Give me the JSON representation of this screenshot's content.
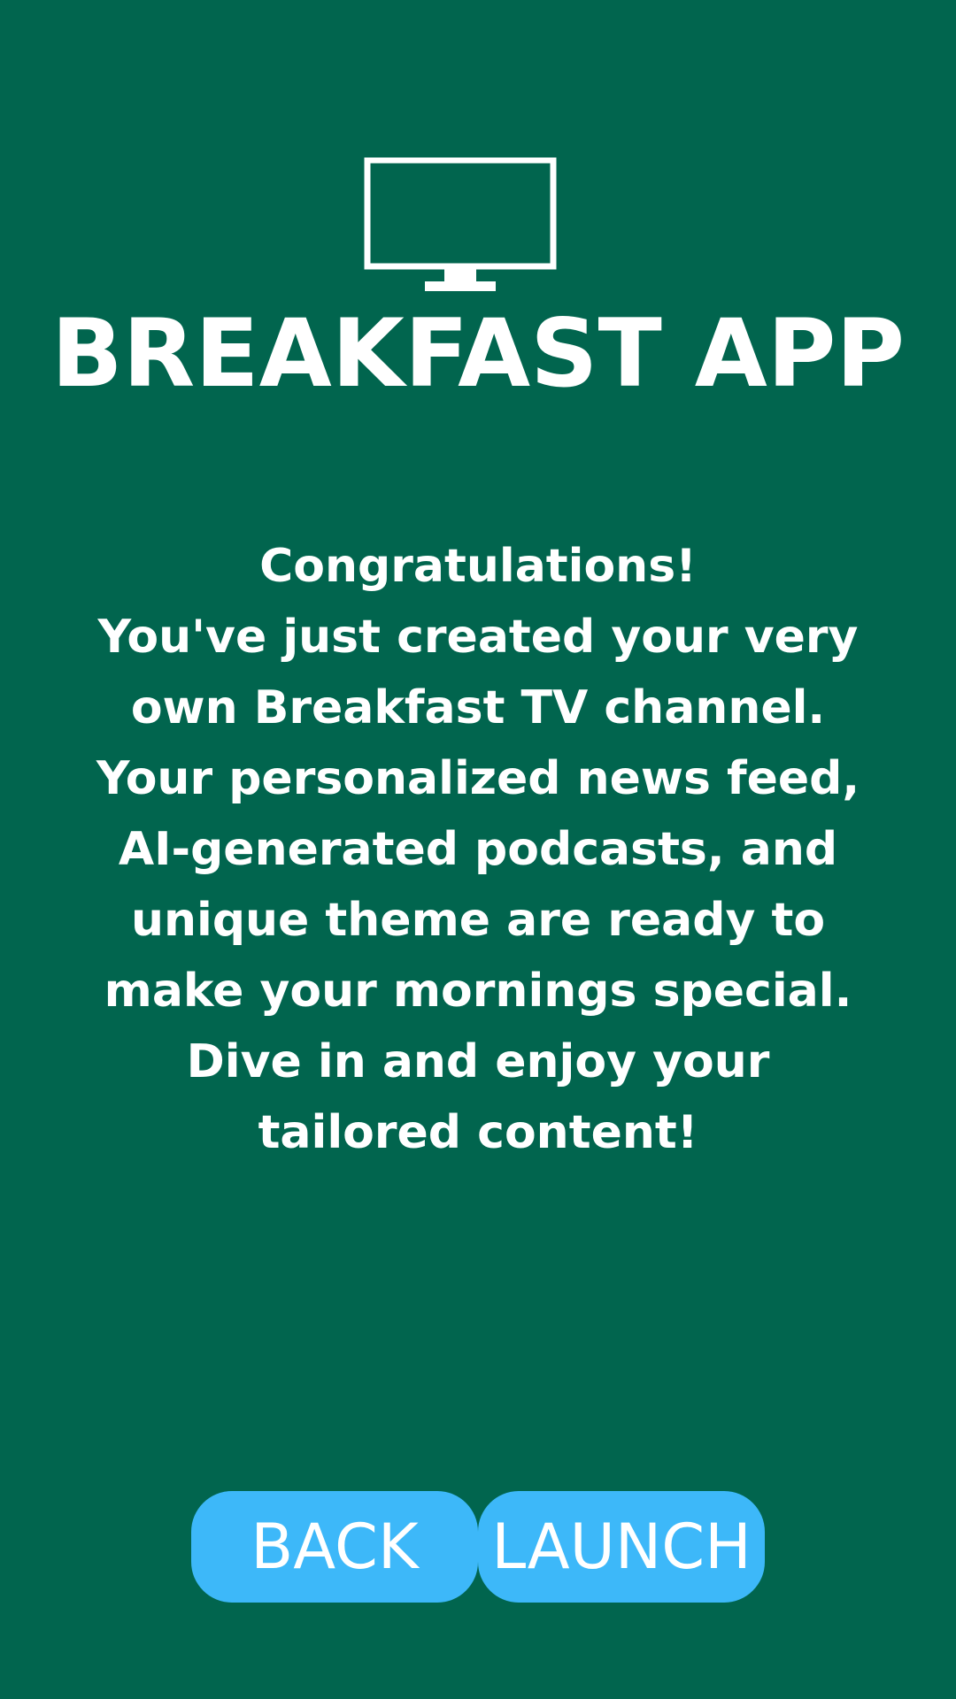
{
  "app": {
    "title": "BREAKFAST APP",
    "logo_icon": "tv-icon"
  },
  "message": {
    "lines": [
      "Congratulations!",
      "You've just created your very",
      "own Breakfast TV channel.",
      "Your personalized news feed,",
      "AI-generated podcasts, and",
      "unique theme are ready to",
      "make your mornings special.",
      "Dive in and enjoy your",
      "tailored content!"
    ]
  },
  "buttons": {
    "back_label": "BACK",
    "launch_label": "LAUNCH"
  },
  "colors": {
    "background": "#01654E",
    "button": "#3DB8F9",
    "text": "#FFFFFF"
  }
}
